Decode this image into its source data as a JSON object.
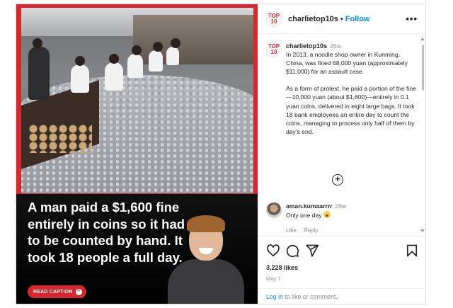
{
  "post": {
    "media": {
      "headline": "A man paid a $1,600 fine entirely in coins so it had to be counted by hand. It took 18 people a full day.",
      "read_caption_label": "READ CAPTION"
    },
    "header": {
      "avatar_logo": "TOP 10",
      "username": "charlietop10s",
      "separator": "•",
      "follow_label": "Follow",
      "more_label": "•••"
    },
    "caption": {
      "username": "charlietop10s",
      "time": "26w",
      "paragraph_1": "In 2013, a noodle shop owner in Kunming, China, was fined 68,000 yuan (approximately $11,000) for an assault case.",
      "paragraph_2": "As a form of protest, he paid a portion of the fine—10,000 yuan (about $1,600)—entirely in 0.1 yuan coins, delivered in eight large bags. It took 18 bank employees an entire day to count the coins, managing to process only half of them by day's end."
    },
    "load_more_label": "+",
    "comment": {
      "username": "aman.kumaarrrr",
      "time": "26w",
      "text": "Only one day",
      "emoji": "surprised-face",
      "like_label": "Like",
      "reply_label": "Reply"
    },
    "footer": {
      "icons": [
        "heart-icon",
        "comment-icon",
        "share-icon",
        "bookmark-icon"
      ],
      "likes": "3,228 likes",
      "date": "May 7",
      "login_link": "Log in",
      "login_rest": " to like or comment."
    },
    "colors": {
      "brand_red": "#d9262c",
      "follow_blue": "#0095f6",
      "muted": "#8e8e8e"
    }
  }
}
